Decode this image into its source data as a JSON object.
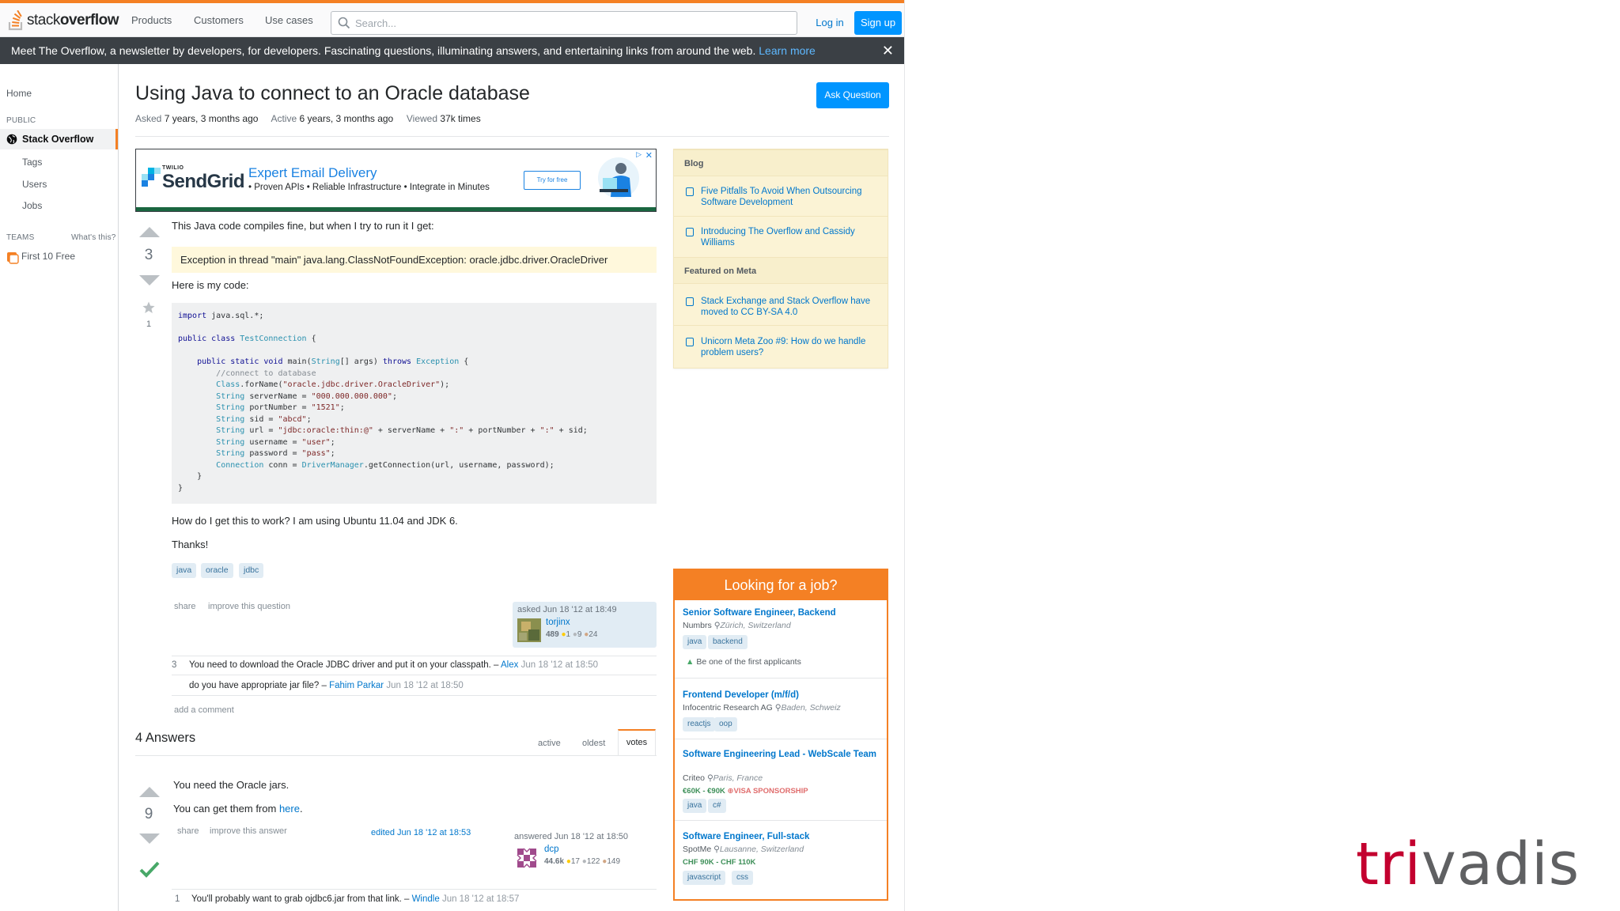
{
  "topbar": {
    "logo_prefix": "stack",
    "logo_suffix": "overflow",
    "nav": [
      "Products",
      "Customers",
      "Use cases"
    ],
    "search_placeholder": "Search...",
    "login": "Log in",
    "signup": "Sign up"
  },
  "banner": {
    "text": "Meet The Overflow, a newsletter by developers, for developers. Fascinating questions, illuminating answers, and entertaining links from around the web.",
    "link": "Learn more",
    "close": "✕"
  },
  "leftnav": {
    "home": "Home",
    "public": "PUBLIC",
    "stackoverflow": "Stack Overflow",
    "tags": "Tags",
    "users": "Users",
    "jobs": "Jobs",
    "teams": "TEAMS",
    "whats_this": "What's this?",
    "first_free": "First 10 Free"
  },
  "question": {
    "title": "Using Java to connect to an Oracle database",
    "asked_label": "Asked",
    "asked_value": "7 years, 3 months ago",
    "active_label": "Active",
    "active_value": "6 years, 3 months ago",
    "viewed_label": "Viewed",
    "viewed_value": "37k times",
    "ask_button": "Ask Question",
    "votes": "3",
    "favorites": "1",
    "intro": "This Java code compiles fine, but when I try to run it I get:",
    "exception": "Exception in thread \"main\" java.lang.ClassNotFoundException: oracle.jdbc.driver.OracleDriver",
    "code_intro": "Here is my code:",
    "outro1": "How do I get this to work? I am using Ubuntu 11.04 and JDK 6.",
    "outro2": "Thanks!",
    "tags": [
      "java",
      "oracle",
      "jdbc"
    ],
    "share": "share",
    "improve": "improve this question",
    "asked_card": {
      "when": "asked Jun 18 '12 at 18:49",
      "user": "torjinx",
      "rep": "489",
      "gold": "1",
      "silver": "9",
      "bronze": "24"
    },
    "comments": [
      {
        "score": "3",
        "text": "You need to download the Oracle JDBC driver and put it on your classpath. –",
        "user": "Alex",
        "date": "Jun 18 '12 at 18:50"
      },
      {
        "score": "",
        "text": "do you have appropriate jar file? –",
        "user": "Fahim Parkar",
        "date": "Jun 18 '12 at 18:50"
      }
    ],
    "add_comment": "add a comment"
  },
  "answers": {
    "title": "4 Answers",
    "sort_active": "active",
    "sort_oldest": "oldest",
    "sort_votes": "votes",
    "first": {
      "votes": "9",
      "line1": "You need the Oracle jars.",
      "line2_prefix": "You can get them from",
      "line2_link": "here",
      "line2_suffix": ".",
      "share": "share",
      "improve": "improve this answer",
      "edited": "edited Jun 18 '12 at 18:53",
      "when": "answered Jun 18 '12 at 18:50",
      "user": "dcp",
      "rep": "44.6k",
      "gold": "17",
      "silver": "122",
      "bronze": "149",
      "comment_score": "1",
      "comment_text": "You'll probably want to grab ojdbc6.jar from that link. –",
      "comment_user": "Windle",
      "comment_date": "Jun 18 '12 at 18:57"
    }
  },
  "ad": {
    "brand_top": "TWILIO",
    "brand": "SendGrid",
    "headline": "Expert Email Delivery",
    "sub": "• Proven APIs • Reliable Infrastructure • Integrate in Minutes",
    "button": "Try for free",
    "close": "✕",
    "play": "▷"
  },
  "sidebar": {
    "blog_head": "Blog",
    "blog_items": [
      "Five Pitfalls To Avoid When Outsourcing Software Development",
      "Introducing The Overflow and Cassidy Williams"
    ],
    "meta_head": "Featured on Meta",
    "meta_items": [
      "Stack Exchange and Stack Overflow have moved to CC BY-SA 4.0",
      "Unicorn Meta Zoo #9: How do we handle problem users?"
    ]
  },
  "jobs": {
    "head": "Looking for a job?",
    "list": [
      {
        "title": "Senior Software Engineer, Backend",
        "company": "Numbrs",
        "location": "Zürich, Switzerland",
        "salary": "",
        "visa": "",
        "tags": [
          "java",
          "backend"
        ],
        "note": "Be one of the first applicants"
      },
      {
        "title": "Frontend Developer (m/f/d)",
        "company": "Infocentric Research AG",
        "location": "Baden, Schweiz",
        "salary": "",
        "visa": "",
        "tags": [
          "reactjs",
          "oop"
        ],
        "note": ""
      },
      {
        "title": "Software Engineering Lead - WebScale Team",
        "company": "Criteo",
        "location": "Paris, France",
        "salary": "€60K - €90K",
        "visa": "VISA SPONSORSHIP",
        "tags": [
          "java",
          "c#"
        ],
        "note": ""
      },
      {
        "title": "Software Engineer, Full-stack",
        "company": "SpotMe",
        "location": "Lausanne, Switzerland",
        "salary": "CHF 90K - CHF 110K",
        "visa": "",
        "tags": [
          "javascript",
          "css"
        ],
        "note": ""
      }
    ]
  },
  "watermark": {
    "part1": "tri",
    "part2": "vadis"
  },
  "colors": {
    "accent_orange": "#f48024",
    "link_blue": "#0077cc",
    "button_blue": "#0095ff",
    "banner_dark": "#3b4045",
    "trivadis_red": "#c3002f",
    "trivadis_gray": "#5f6062"
  }
}
